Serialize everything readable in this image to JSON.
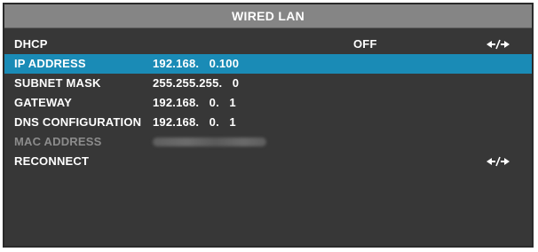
{
  "window": {
    "title": "WIRED LAN"
  },
  "menu": [
    {
      "label": "DHCP",
      "value": "",
      "state": "OFF",
      "icon": "left-right-arrow-icon"
    },
    {
      "label": "IP ADDRESS",
      "value": "192.168.   0.100",
      "state": "",
      "icon": "",
      "selected": true
    },
    {
      "label": "SUBNET MASK",
      "value": "255.255.255.   0",
      "state": "",
      "icon": ""
    },
    {
      "label": "GATEWAY",
      "value": "192.168.   0.   1",
      "state": "",
      "icon": ""
    },
    {
      "label": "DNS CONFIGURATION",
      "value": "192.168.   0.   1",
      "state": "",
      "icon": ""
    },
    {
      "label": "MAC ADDRESS",
      "value": "",
      "state": "",
      "icon": "",
      "disabled": true
    },
    {
      "label": "RECONNECT",
      "value": "",
      "state": "",
      "icon": "left-right-arrow-icon"
    }
  ],
  "colors": {
    "background": "#373737",
    "title_bar": "#858585",
    "selection": "#1a8bb6",
    "text": "#ffffff",
    "disabled_text": "#8c8c8c"
  }
}
